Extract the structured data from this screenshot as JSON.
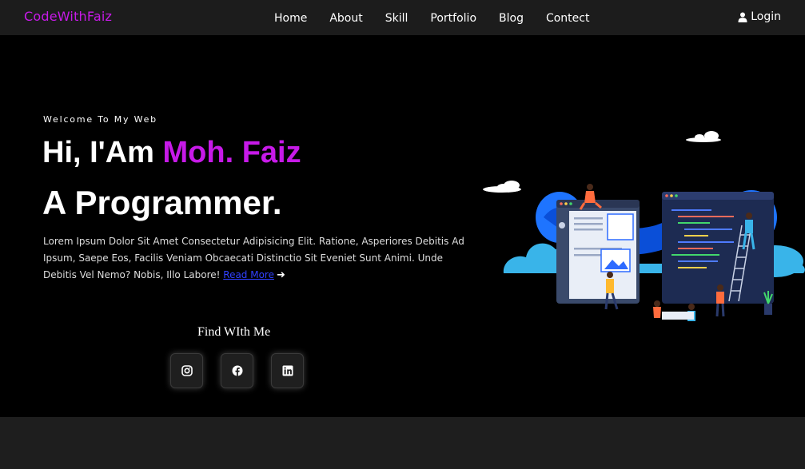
{
  "nav": {
    "brand": "CodeWithFaiz",
    "links": [
      "Home",
      "About",
      "Skill",
      "Portfolio",
      "Blog",
      "Contect"
    ],
    "login": "Login"
  },
  "hero": {
    "welcome": "Welcome To My Web",
    "greeting": "Hi, I'Am ",
    "name": "Moh. Faiz",
    "role": "A Programmer.",
    "description": "Lorem Ipsum Dolor Sit Amet Consectetur Adipisicing Elit. Ratione, Asperiores Debitis Ad Ipsum, Saepe Eos, Facilis Veniam Obcaecati Distinctio Sit Eveniet Sunt Animi. Unde Debitis Vel Nemo? Nobis, Illo Labore!",
    "read_more": "Read More"
  },
  "social": {
    "title": "Find WIth Me",
    "icons": [
      "instagram-icon",
      "facebook-icon",
      "linkedin-icon"
    ]
  },
  "colors": {
    "accent": "#c71ae8",
    "background": "#000000",
    "navbar": "#1c1c1c",
    "link": "#3040ff"
  }
}
